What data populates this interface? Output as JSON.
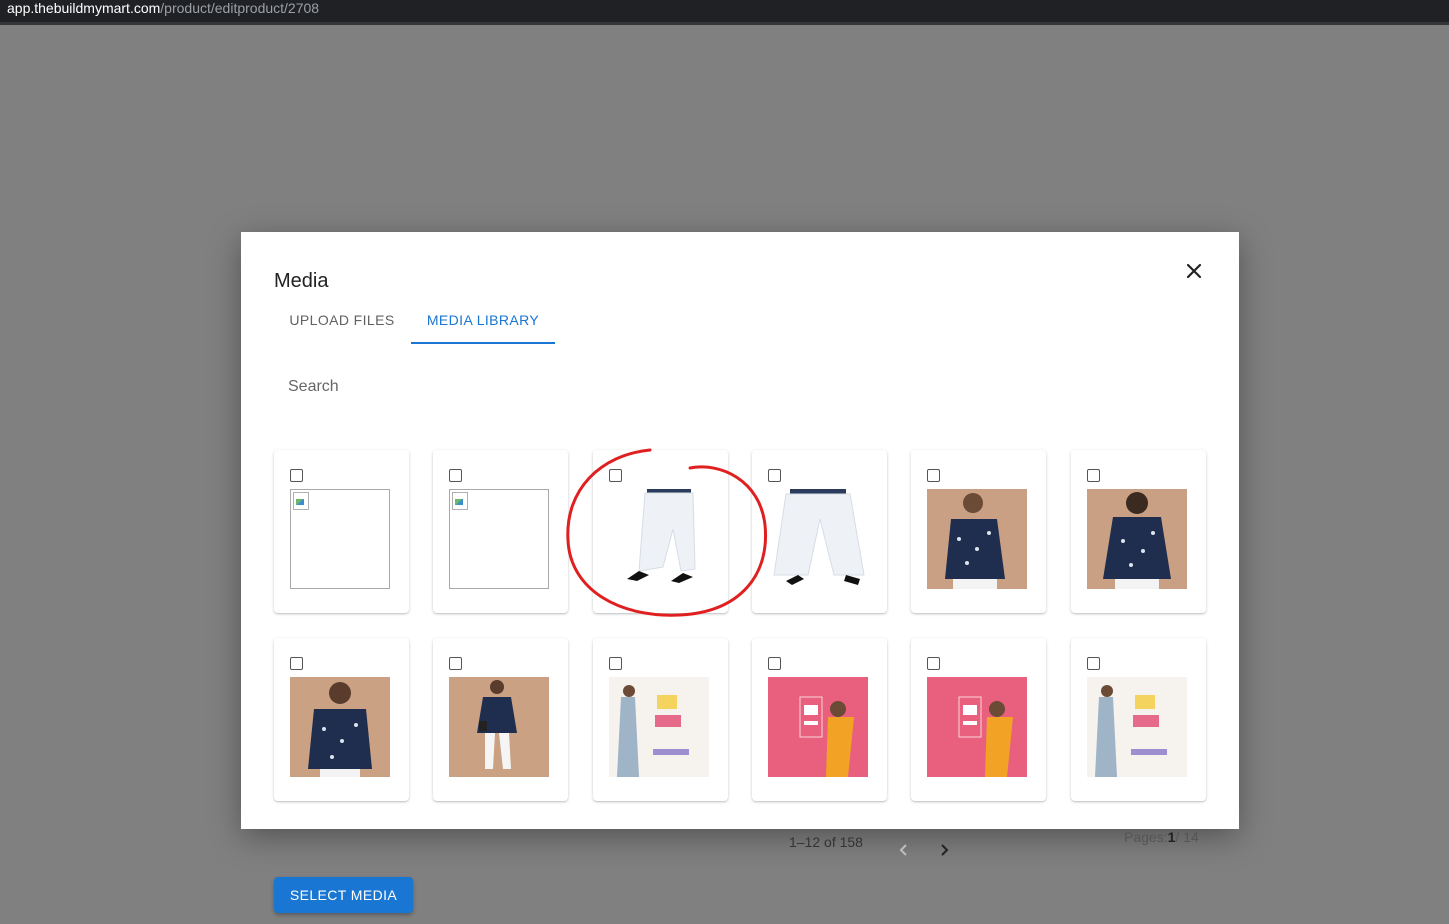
{
  "browser": {
    "url_host": "app.thebuildmymart.com",
    "url_path": "/product/editproduct/2708"
  },
  "modal": {
    "title": "Media",
    "close_icon": "close-icon",
    "tabs": [
      {
        "label": "UPLOAD FILES",
        "active": false
      },
      {
        "label": "MEDIA LIBRARY",
        "active": true
      }
    ],
    "search_placeholder": "Search",
    "accent_color": "#1976d2",
    "media": [
      {
        "kind": "broken",
        "checked": false
      },
      {
        "kind": "broken",
        "checked": false
      },
      {
        "kind": "white-pants-side",
        "checked": false,
        "annotated": true
      },
      {
        "kind": "white-pants-front",
        "checked": false
      },
      {
        "kind": "blue-top-front",
        "checked": false
      },
      {
        "kind": "blue-top-back",
        "checked": false
      },
      {
        "kind": "blue-top-model",
        "checked": false
      },
      {
        "kind": "blue-top-full",
        "checked": false
      },
      {
        "kind": "sale-banner-light",
        "checked": false
      },
      {
        "kind": "sale-banner-pink",
        "checked": false
      },
      {
        "kind": "sale-banner-pink",
        "checked": false
      },
      {
        "kind": "sale-banner-light",
        "checked": false
      }
    ]
  },
  "pagination": {
    "range_label": "1–12 of 158",
    "pages_prefix": "Pages:",
    "current_page": "1",
    "pages_suffix": "/ 14"
  },
  "footer": {
    "select_label": "SELECT MEDIA"
  }
}
